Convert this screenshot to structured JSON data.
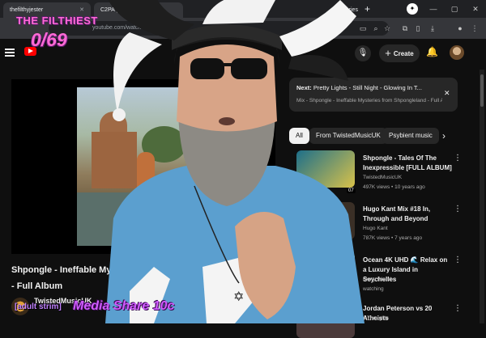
{
  "browser": {
    "tabs": [
      {
        "label": "thefilthyjester"
      },
      {
        "label": "C2PA | Verifying M"
      },
      {
        "label": "Mysteries"
      }
    ],
    "new_tab": "+",
    "window_controls": [
      "—",
      "▢",
      "✕"
    ],
    "url": "youtube.com/watch?v=k4..."
  },
  "youtube": {
    "create_label": "Create"
  },
  "player": {
    "video_title_line1": "Shpongle - Ineffable My",
    "video_title_line2": "- Full Album",
    "channel_name": "TwistedMusicUK"
  },
  "sidebar": {
    "next_label": "Next:",
    "next_title": "Pretty Lights - Still Night - Glowing In T...",
    "next_subtitle": "Mix - Shpongle - Ineffable Mysteries from Shpongleland - Full Al",
    "chips": [
      "All",
      "From TwistedMusicUK",
      "Psybient music"
    ],
    "recommendations": [
      {
        "title": "Shpongle - Tales Of The Inexpressible [FULL ALBUM]",
        "channel": "TwistedMusicUK",
        "meta": "497K views • 10 years ago",
        "duration": "07"
      },
      {
        "title": "Hugo Kant Mix #18 In, Through and Beyond",
        "channel": "Hugo Kant",
        "meta": "787K views • 7 years ago",
        "duration": ""
      },
      {
        "title": "Ocean 4K UHD 🌊 Relax on a Luxury Island in Seychelles",
        "channel": "uxury Island",
        "meta": "watching",
        "duration": ""
      },
      {
        "title": "Jordan Peterson vs 20 Atheists",
        "channel": "y Thoughts",
        "meta": "",
        "duration": ""
      }
    ]
  },
  "overlay": {
    "title": "THE FILTHIEST",
    "count": "0/69",
    "tag": "[adult strim]",
    "media_share": "Media Share 10c"
  }
}
